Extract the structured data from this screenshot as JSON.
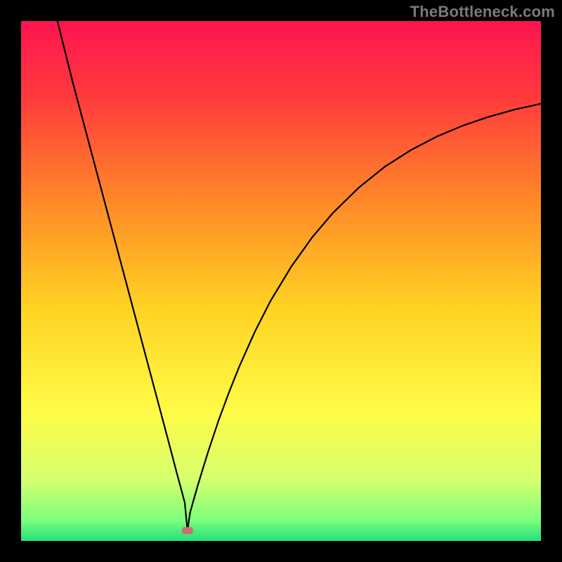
{
  "watermark": {
    "text": "TheBottleneck.com"
  },
  "chart_data": {
    "type": "line",
    "title": "",
    "xlabel": "",
    "ylabel": "",
    "xlim": [
      0,
      100
    ],
    "ylim": [
      0,
      100
    ],
    "grid": false,
    "legend": false,
    "background_gradient_stops": [
      {
        "pos": 0.0,
        "color": "#ff1450"
      },
      {
        "pos": 0.15,
        "color": "#ff3c3c"
      },
      {
        "pos": 0.35,
        "color": "#ff8a28"
      },
      {
        "pos": 0.55,
        "color": "#ffd223"
      },
      {
        "pos": 0.75,
        "color": "#fffb46"
      },
      {
        "pos": 0.88,
        "color": "#d7ff6e"
      },
      {
        "pos": 0.96,
        "color": "#7dff7d"
      },
      {
        "pos": 1.0,
        "color": "#22e07a"
      }
    ],
    "minimum_marker": {
      "x": 32,
      "y": 2,
      "color": "#cc6e73"
    },
    "series": [
      {
        "name": "curve",
        "color": "#000000",
        "x_values": [
          7,
          8,
          9,
          10,
          12,
          14,
          16,
          18,
          20,
          22,
          24,
          26,
          28,
          29,
          30,
          31,
          31.5,
          32,
          32.5,
          33,
          34,
          35,
          36,
          38,
          40,
          42,
          45,
          48,
          52,
          56,
          60,
          65,
          70,
          75,
          80,
          85,
          90,
          95,
          100
        ],
        "y_values": [
          100,
          96,
          92,
          88,
          80.5,
          73,
          65.5,
          58,
          50.5,
          43,
          35.5,
          28,
          20.5,
          16.7,
          12.9,
          9.2,
          7.3,
          2,
          5.4,
          7.2,
          10.7,
          14,
          17.2,
          23.2,
          28.6,
          33.6,
          40.3,
          46.2,
          52.8,
          58.4,
          63.1,
          68,
          72,
          75.2,
          77.8,
          79.9,
          81.6,
          83,
          84.1
        ]
      }
    ]
  }
}
